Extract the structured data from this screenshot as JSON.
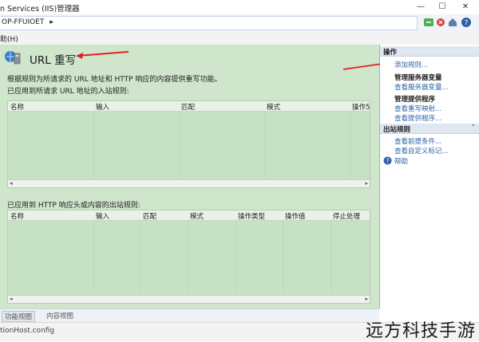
{
  "window": {
    "title": "n Services (IIS)管理器",
    "minimize": "—",
    "maximize": "☐",
    "close": "✕"
  },
  "address": {
    "path": "OP-FFUIOET",
    "arrow": "▸"
  },
  "menu": {
    "help": "助(H)"
  },
  "main": {
    "title": "URL 重写",
    "description": "根据规则为所请求的 URL 地址和 HTTP 响应的内容提供重写功能。",
    "inbound": {
      "heading": "已应用到所请求 URL 地址的入站规则:",
      "columns": [
        "名称",
        "输入",
        "匹配",
        "模式",
        "操作5"
      ]
    },
    "outbound": {
      "heading": "已应用到 HTTP 响应头或内容的出站规则:",
      "columns": [
        "名称",
        "输入",
        "匹配",
        "模式",
        "操作类型",
        "操作值",
        "停止处理"
      ]
    }
  },
  "actions": {
    "header": "操作",
    "add_rule": "添加规则...",
    "server_vars": {
      "title": "管理服务器变量",
      "view": "查看服务器变量..."
    },
    "providers": {
      "title": "管理提供程序",
      "view_maps": "查看重写映射...",
      "view_providers": "查看提供程序..."
    },
    "outbound_rules": {
      "header": "出站规则",
      "preconditions": "查看前提条件...",
      "custom_tags": "查看自定义标记..."
    },
    "help": "帮助"
  },
  "view_tabs": {
    "features": "功能视图",
    "content": "内容视图"
  },
  "status": {
    "text": "tionHost.config"
  },
  "watermark": "远方科技手游",
  "colors": {
    "pane_bg": "#cfe6cc",
    "link": "#2c66a8",
    "arrow": "#e02020"
  }
}
